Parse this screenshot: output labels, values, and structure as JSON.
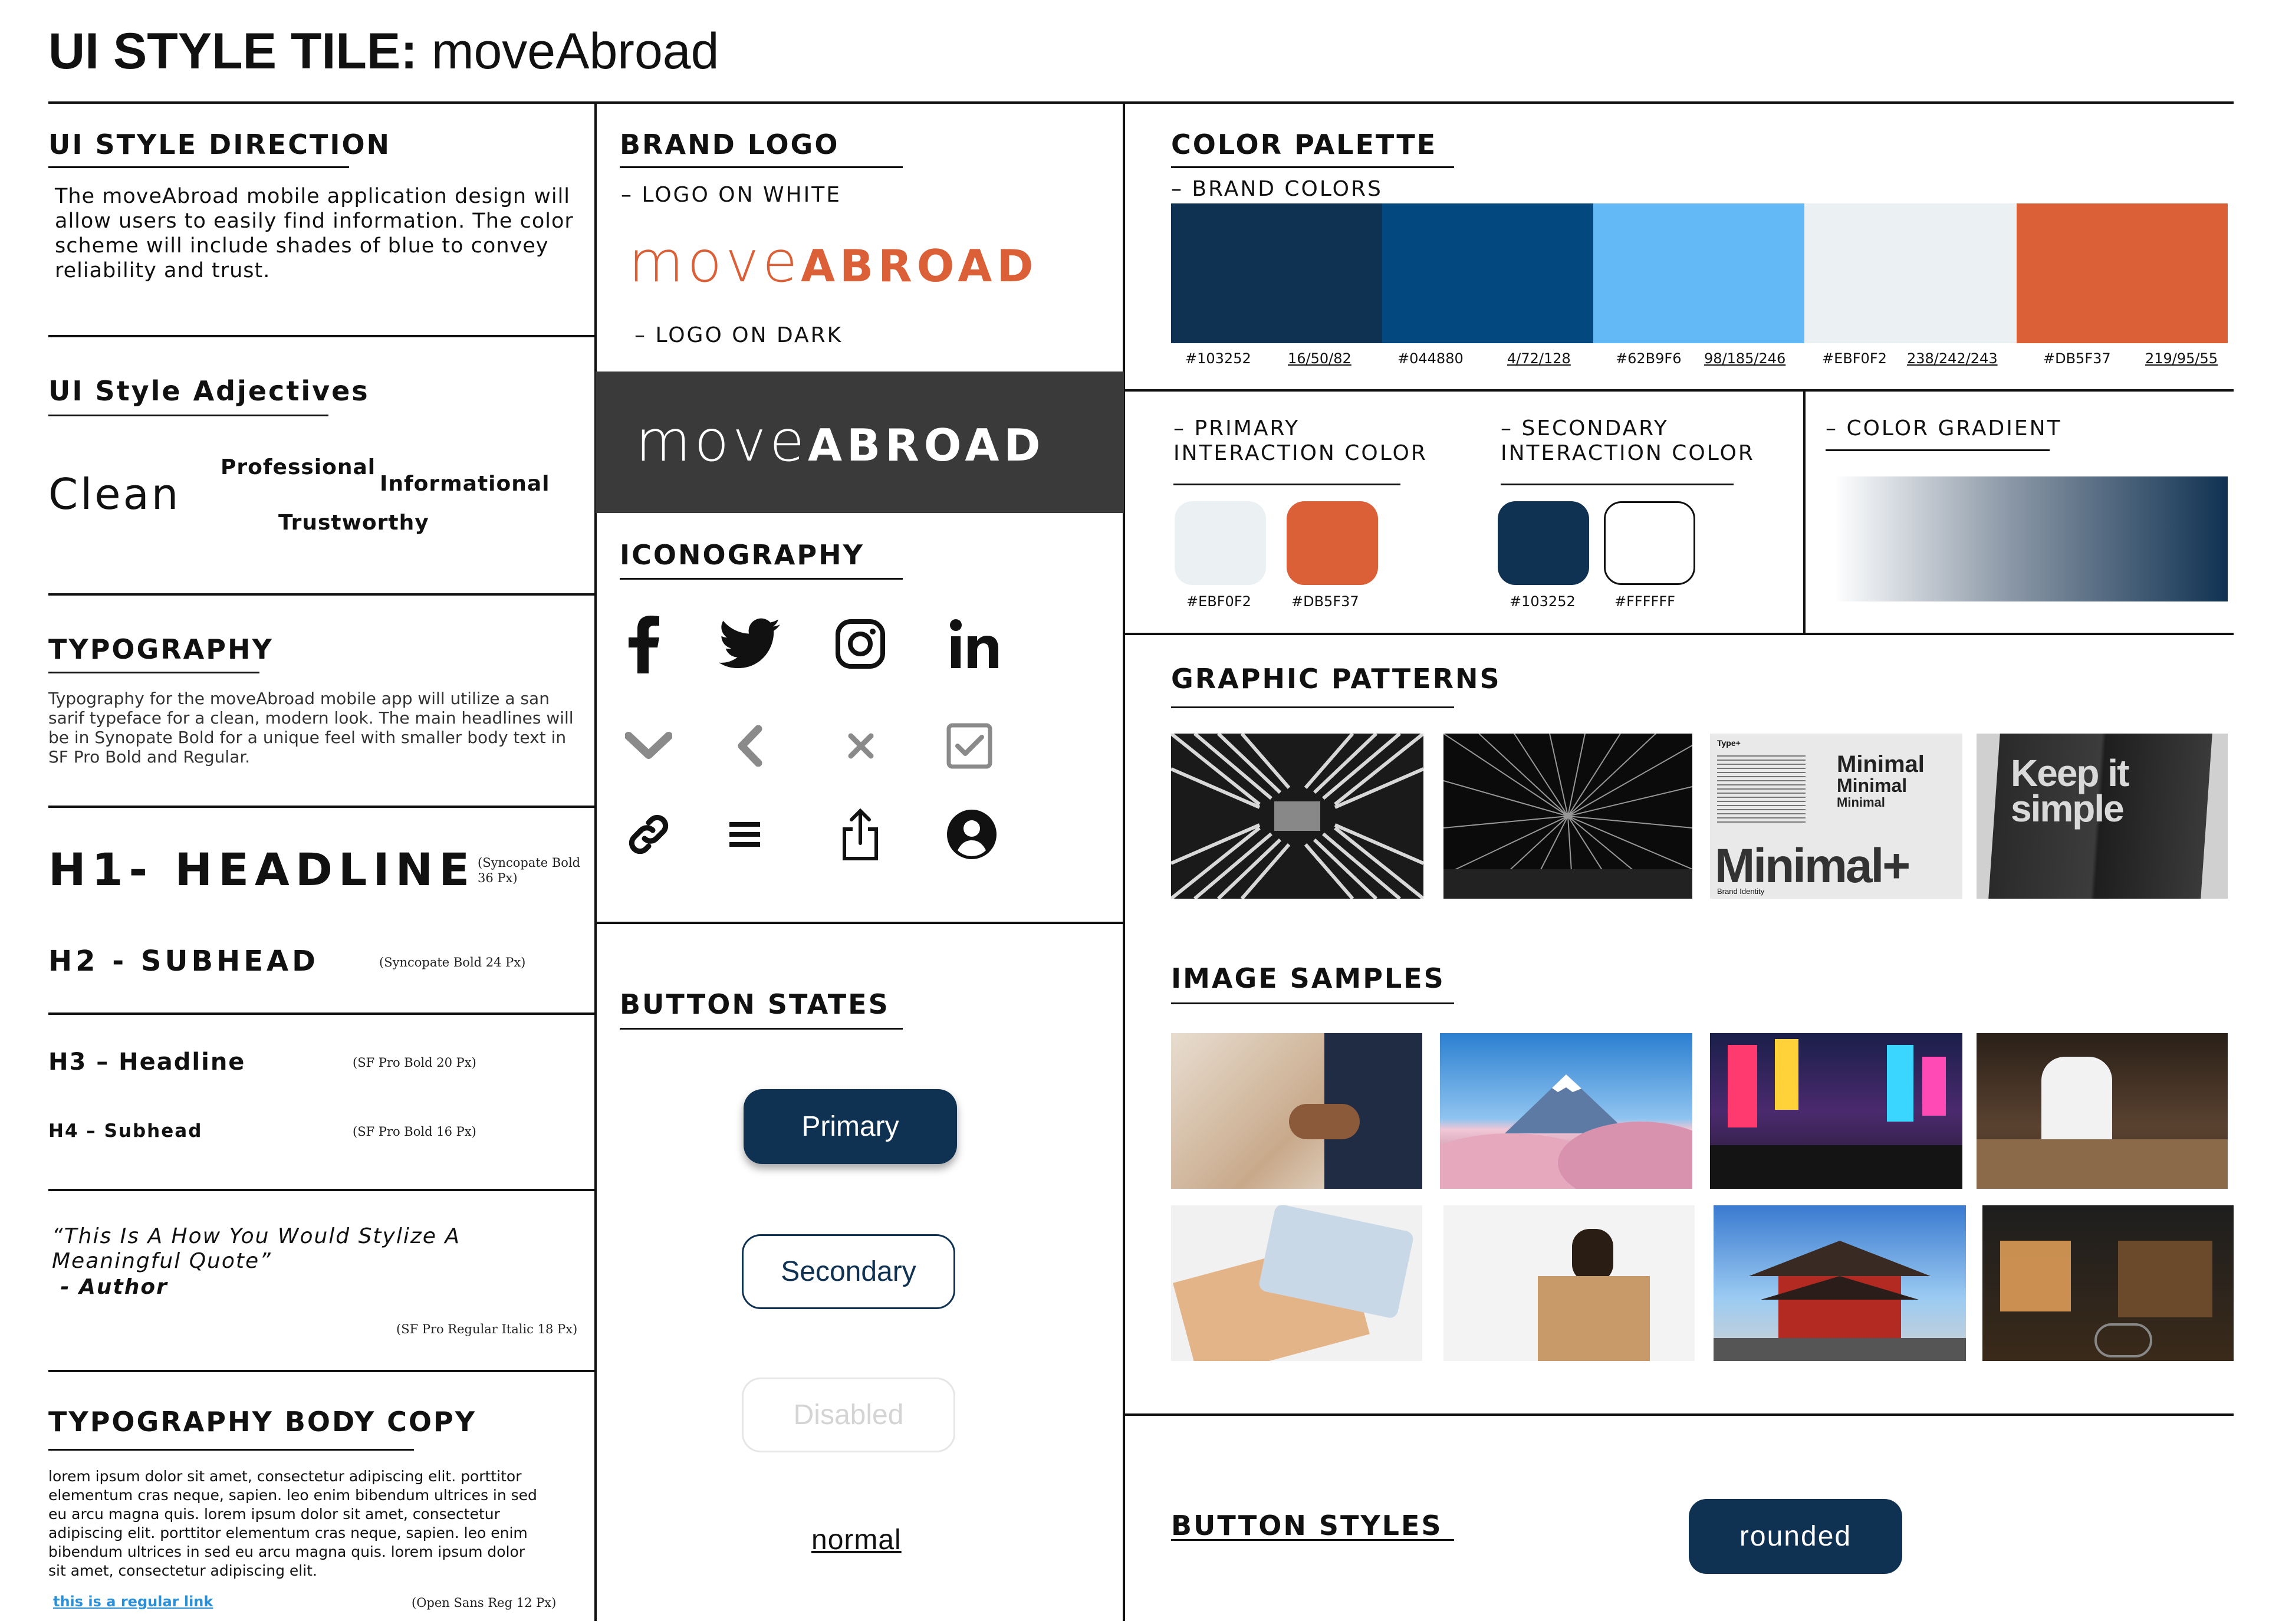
{
  "header": {
    "title_bold": "UI STYLE TILE:",
    "title_regular": "moveAbroad"
  },
  "direction": {
    "title": "UI STYLE DIRECTION",
    "body": "The moveAbroad mobile application design will allow users to easily find information. The color scheme will include shades of blue to convey reliability and trust."
  },
  "adjectives": {
    "title": "UI Style Adjectives",
    "words": [
      "Clean",
      "Professional",
      "Informational",
      "Trustworthy"
    ]
  },
  "typography": {
    "title": "TYPOGRAPHY",
    "body": "Typography for the moveAbroad mobile app will utilize a san sarif typeface for a clean, modern look. The main headlines will be in Synopate Bold for a unique feel with smaller body text in SF Pro Bold and Regular.",
    "h1": "H1- HEADLINE",
    "h1_note": "(Syncopate Bold 36 Px)",
    "h2": "H2 - SUBHEAD",
    "h2_note": "(Syncopate Bold 24 Px)",
    "h3": "H3 – Headline",
    "h3_note": "(SF Pro Bold 20 Px)",
    "h4": "H4 – Subhead",
    "h4_note": "(SF Pro Bold 16 Px)",
    "quote": "“This Is A How You Would Stylize A Meaningful Quote”",
    "quote_author": " - Author",
    "quote_note": "(SF Pro Regular Italic 18 Px)"
  },
  "body_copy": {
    "title": "TYPOGRAPHY BODY COPY",
    "text": "lorem ipsum dolor sit amet, consectetur adipiscing elit. porttitor elementum cras neque, sapien. leo enim bibendum ultrices in sed eu arcu magna quis. lorem ipsum dolor sit amet, consectetur adipiscing elit. porttitor elementum cras neque, sapien. leo enim bibendum ultrices in sed eu arcu magna quis. lorem ipsum dolor sit amet, consectetur adipiscing elit.",
    "link": "this is a regular link",
    "note": "(Open Sans Reg 12 Px)"
  },
  "brand_logo": {
    "title": "BRAND LOGO",
    "on_white": "– LOGO ON WHITE",
    "on_dark": "– LOGO ON DARK",
    "logo_part1": "move",
    "logo_part2": "ABROAD"
  },
  "iconography": {
    "title": "ICONOGRAPHY",
    "icons": [
      "facebook-icon",
      "twitter-icon",
      "instagram-icon",
      "linkedin-icon",
      "chevron-down-icon",
      "chevron-left-icon",
      "close-icon",
      "checkbox-icon",
      "link-icon",
      "menu-icon",
      "share-icon",
      "user-icon"
    ]
  },
  "button_states": {
    "title": "BUTTON STATES",
    "primary": "Primary",
    "secondary": "Secondary",
    "disabled": "Disabled",
    "normal": "normal"
  },
  "palette": {
    "title": "COLOR PALETTE",
    "brand_colors_label": "– BRAND COLORS",
    "colors": [
      {
        "hex": "#103252",
        "rgb": "16/50/82"
      },
      {
        "hex": "#044880",
        "rgb": "4/72/128"
      },
      {
        "hex": "#62B9F6",
        "rgb": "98/185/246"
      },
      {
        "hex": "#EBF0F2",
        "rgb": "238/242/243"
      },
      {
        "hex": "#DB5F37",
        "rgb": "219/95/55"
      }
    ]
  },
  "interaction": {
    "primary_title_1": "– PRIMARY",
    "primary_title_2": "INTERACTION COLOR",
    "secondary_title_1": "– SECONDARY",
    "secondary_title_2": "INTERACTION COLOR",
    "primary_chips": [
      "#EBF0F2",
      "#DB5F37"
    ],
    "secondary_chips": [
      "#103252",
      "#FFFFFF"
    ],
    "gradient_title": "– COLOR GRADIENT"
  },
  "patterns": {
    "title": "GRAPHIC PATTERNS",
    "minimal_word": "Minimal+",
    "minimal_small": "Minimal",
    "keep_it": "Keep it",
    "simple": "simple",
    "type_plus": "Type+",
    "brand_identity": "Brand Identity"
  },
  "samples": {
    "title": "IMAGE SAMPLES"
  },
  "button_styles": {
    "title": "BUTTON STYLES",
    "rounded": "rounded"
  }
}
